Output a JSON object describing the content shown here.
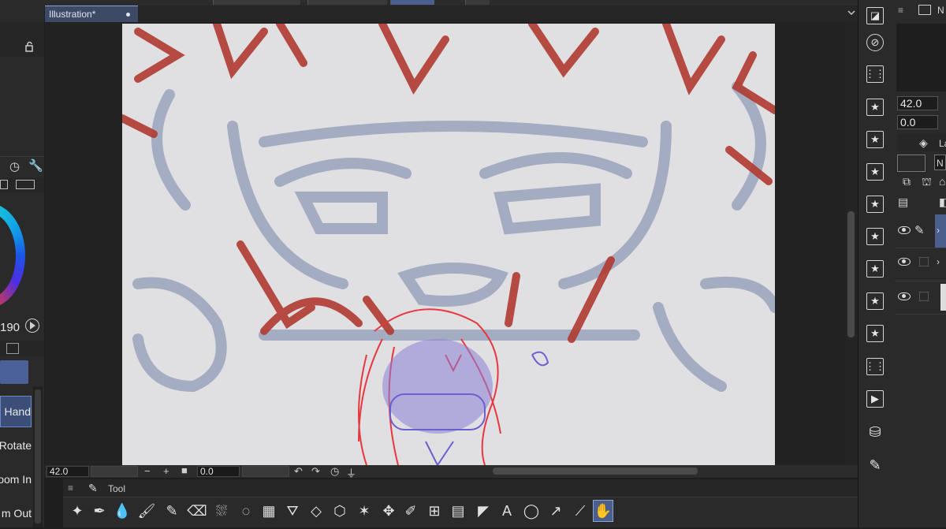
{
  "document": {
    "tab_title": "Illustration*"
  },
  "left_panel": {
    "color_value": "190",
    "subtools": [
      {
        "label": "Hand",
        "selected": true
      },
      {
        "label": "Rotate",
        "selected": false
      },
      {
        "label": "oom In",
        "selected": false
      },
      {
        "label": "m Out",
        "selected": false
      }
    ]
  },
  "statusbar": {
    "zoom": "42.0",
    "minus": "−",
    "plus": "+",
    "rotation": "0.0"
  },
  "tool_palette": {
    "title": "Tool",
    "tools": [
      {
        "icon": "sparkle-icon",
        "glyph": "✦"
      },
      {
        "icon": "pen-icon",
        "glyph": "✒",
        "selected": false
      },
      {
        "icon": "droplets-icon",
        "glyph": "💧"
      },
      {
        "icon": "brush-icon",
        "glyph": "🖌"
      },
      {
        "icon": "pencil-icon",
        "glyph": "✎"
      },
      {
        "icon": "eraser-icon",
        "glyph": "⌫"
      },
      {
        "icon": "decoration-icon",
        "glyph": "⛆"
      },
      {
        "icon": "blend-icon",
        "glyph": "◌"
      },
      {
        "icon": "gradient-icon",
        "glyph": "▦"
      },
      {
        "icon": "fill-icon",
        "glyph": "⛛"
      },
      {
        "icon": "erase-fill-icon",
        "glyph": "◇"
      },
      {
        "icon": "3d-object-icon",
        "glyph": "⬡"
      },
      {
        "icon": "auto-select-icon",
        "glyph": "✶"
      },
      {
        "icon": "move-icon",
        "glyph": "✥"
      },
      {
        "icon": "operation-icon",
        "glyph": "✐"
      },
      {
        "icon": "grid-icon",
        "glyph": "⊞"
      },
      {
        "icon": "frame-icon",
        "glyph": "▤"
      },
      {
        "icon": "ruler-icon",
        "glyph": "◤"
      },
      {
        "icon": "text-icon",
        "glyph": "A"
      },
      {
        "icon": "balloon-icon",
        "glyph": "◯"
      },
      {
        "icon": "correct-line-icon",
        "glyph": "↗"
      },
      {
        "icon": "eyedropper-icon",
        "glyph": "⟋"
      },
      {
        "icon": "hand-icon",
        "glyph": "✋",
        "selected": true
      }
    ]
  },
  "right_panel": {
    "field1": "42.0",
    "field2": "0.0",
    "layer_tab_label": "La",
    "blend_label": "N",
    "nav_label": "N"
  }
}
